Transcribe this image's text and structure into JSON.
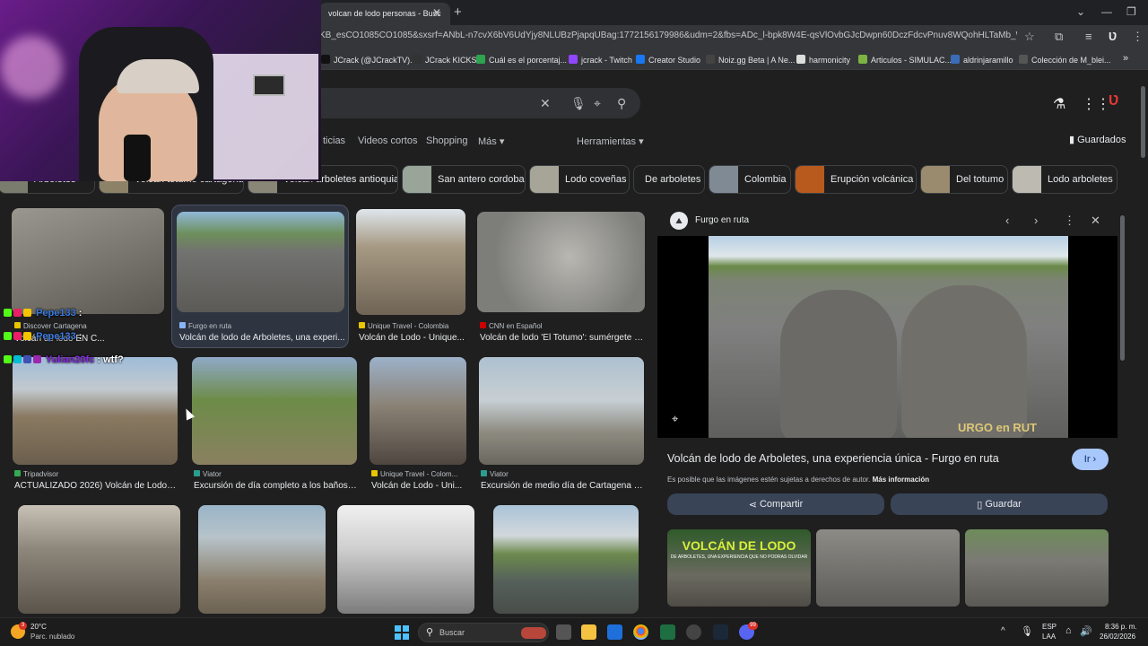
{
  "browser": {
    "tab_title": "volcan de lodo personas - Busc",
    "url": "KB_esCO1085CO1085&sxsrf=ANbL-n7cvX6bV6UdYjy8NLUBzPjapqUBag:1772156179986&udm=2&fbs=ADc_l-bpk8W4E-qsVlOvbGJcDwpn60DczFdcvPnuv8WQohHLTaMb_WtLz8zQ41bNqi...",
    "bookmarks": [
      {
        "label": "JCrack (@JCrackTV)...",
        "color": "#111111"
      },
      {
        "label": "JCrack KICKS",
        "color": "#333333"
      },
      {
        "label": "Cuál es el porcentaj...",
        "color": "#2da44e"
      },
      {
        "label": "jcrack - Twitch",
        "color": "#9146ff"
      },
      {
        "label": "Creator Studio",
        "color": "#1877f2"
      },
      {
        "label": "Noiz.gg Beta | A Ne...",
        "color": "#444444"
      },
      {
        "label": "harmonicity",
        "color": "#dddddd"
      },
      {
        "label": "Articulos - SIMULAC...",
        "color": "#7cb342"
      },
      {
        "label": "aldrinjaramillo",
        "color": "#3b6cb7"
      },
      {
        "label": "Colección de M_blei...",
        "color": "#555555"
      }
    ]
  },
  "search": {
    "nav_tabs": [
      "ticias",
      "Videos cortos",
      "Shopping",
      "Más ▾"
    ],
    "tools_label": "Herramientas ▾",
    "saved_label": "Guardados",
    "chips": [
      {
        "label": "Arboletes",
        "color": "#7a7d6e"
      },
      {
        "label": "Volcán totumo cartagena",
        "color": "#8c8268"
      },
      {
        "label": "Volcán arboletes antioquia",
        "color": "#8a8677"
      },
      {
        "label": "San antero cordoba",
        "color": "#9aa59a"
      },
      {
        "label": "Lodo coveñas",
        "color": "#a7a498"
      },
      {
        "label": "De arboletes",
        "color": ""
      },
      {
        "label": "Colombia",
        "color": "#7f8a94"
      },
      {
        "label": "Erupción volcánica",
        "color": "#b85a1e"
      },
      {
        "label": "Del totumo",
        "color": "#9b8b6e"
      },
      {
        "label": "Lodo arboletes",
        "color": "#bdbab2"
      }
    ]
  },
  "results": [
    {
      "source": "Discover Cartagena",
      "title": "Volcán de lodo EN C...",
      "src_color": "#e8c500",
      "c1": "#8e8c86",
      "c2": "#5d5b55"
    },
    {
      "source": "Furgo en ruta",
      "title": "Volcán de lodo de Arboletes, una experi...",
      "src_color": "#8ab4f8",
      "c1": "#6d8f5b",
      "c2": "#6a6a66"
    },
    {
      "source": "Unique Travel - Colombia",
      "title": "Volcán de Lodo - Unique...",
      "src_color": "#e8c500",
      "c1": "#a79a84",
      "c2": "#6f6455"
    },
    {
      "source": "CNN en Español",
      "title": "Volcán de lodo 'El Totumo': sumérgete e...",
      "src_color": "#cc0000",
      "c1": "#a3a3a0",
      "c2": "#6e6e6b"
    },
    {
      "source": "Tripadvisor",
      "title": "ACTUALIZADO 2026) Volcán de Lodo d...",
      "src_color": "#34a853",
      "c1": "#9fbcd8",
      "c2": "#7a6a55"
    },
    {
      "source": "Viator",
      "title": "Excursión de día completo a los baños ...",
      "src_color": "#2a9d8f",
      "c1": "#8fa9c7",
      "c2": "#5c7a3a"
    },
    {
      "source": "Unique Travel - Colom...",
      "title": "Volcán de Lodo - Uni...",
      "src_color": "#e8c500",
      "c1": "#9cb1c9",
      "c2": "#544b45"
    },
    {
      "source": "Viator",
      "title": "Excursión de medio día de Cartagena al...",
      "src_color": "#2a9d8f",
      "c1": "#aec0cf",
      "c2": "#7a776f"
    },
    {
      "source": "",
      "title": "",
      "src_color": "",
      "c1": "#9a938a",
      "c2": "#5e5850"
    },
    {
      "source": "",
      "title": "",
      "src_color": "",
      "c1": "#9ab4c8",
      "c2": "#8a7f6c"
    },
    {
      "source": "",
      "title": "",
      "src_color": "",
      "c1": "#dddddd",
      "c2": "#888888"
    },
    {
      "source": "",
      "title": "",
      "src_color": "",
      "c1": "#aac3d8",
      "c2": "#5a6a60"
    }
  ],
  "panel": {
    "site_name": "Furgo en ruta",
    "title": "Volcán de lodo de Arboletes, una experiencia única - Furgo en ruta",
    "visit_label": "Ir",
    "copyright_text": "Es posible que las imágenes estén sujetas a derechos de autor.",
    "more_info": "Más información",
    "share_label": "Compartir",
    "save_label": "Guardar",
    "image_watermark": "URGO en RUT",
    "related_banner_title": "VOLCÁN DE LODO",
    "related_banner_sub": "DE ARBOLETES, UNA EXPERIENCIA QUE NO PODRÁS OLVIDAR"
  },
  "chat": [
    {
      "user": "Pepe133",
      "message": ":",
      "color": "#3c7be0"
    },
    {
      "user": "Pepe133",
      "message": ":",
      "color": "#3c7be0"
    },
    {
      "user": "Yulian20fc",
      "message": ": wtf?",
      "color": "#8a2be2"
    }
  ],
  "taskbar": {
    "temperature": "20°C",
    "weather": "Parc. nublado",
    "weather_badge": "3",
    "search_placeholder": "Buscar",
    "lang_top": "ESP",
    "lang_bottom": "LAA",
    "time": "8:36 p. m.",
    "date": "26/02/2026",
    "discord_badge": "99"
  }
}
